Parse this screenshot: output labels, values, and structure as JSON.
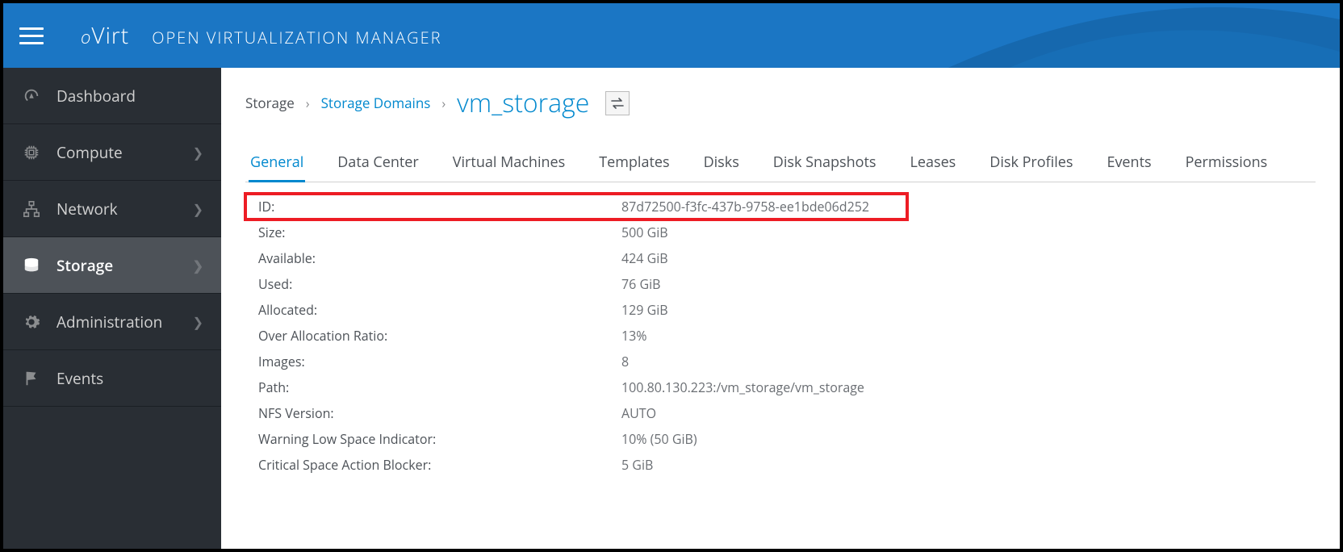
{
  "header": {
    "logo_text": "oVirt",
    "title": "OPEN VIRTUALIZATION MANAGER"
  },
  "sidebar": {
    "items": [
      {
        "id": "dashboard",
        "label": "Dashboard",
        "icon": "gauge",
        "expandable": false
      },
      {
        "id": "compute",
        "label": "Compute",
        "icon": "cpu",
        "expandable": true
      },
      {
        "id": "network",
        "label": "Network",
        "icon": "network",
        "expandable": true
      },
      {
        "id": "storage",
        "label": "Storage",
        "icon": "storage",
        "expandable": true,
        "active": true
      },
      {
        "id": "administration",
        "label": "Administration",
        "icon": "gear",
        "expandable": true
      },
      {
        "id": "events",
        "label": "Events",
        "icon": "flag",
        "expandable": false
      }
    ]
  },
  "breadcrumb": {
    "root": "Storage",
    "mid": "Storage Domains",
    "current": "vm_storage"
  },
  "tabs": [
    "General",
    "Data Center",
    "Virtual Machines",
    "Templates",
    "Disks",
    "Disk Snapshots",
    "Leases",
    "Disk Profiles",
    "Events",
    "Permissions"
  ],
  "active_tab": "General",
  "props": [
    {
      "k": "ID:",
      "v": "87d72500-f3fc-437b-9758-ee1bde06d252",
      "highlight": true
    },
    {
      "k": "Size:",
      "v": "500 GiB"
    },
    {
      "k": "Available:",
      "v": "424 GiB"
    },
    {
      "k": "Used:",
      "v": "76 GiB"
    },
    {
      "k": "Allocated:",
      "v": "129 GiB"
    },
    {
      "k": "Over Allocation Ratio:",
      "v": "13%"
    },
    {
      "k": "Images:",
      "v": "8"
    },
    {
      "k": "Path:",
      "v": "100.80.130.223:/vm_storage/vm_storage"
    },
    {
      "k": "NFS Version:",
      "v": "AUTO"
    },
    {
      "k": "Warning Low Space Indicator:",
      "v": "10% (50 GiB)"
    },
    {
      "k": "Critical Space Action Blocker:",
      "v": "5 GiB"
    }
  ]
}
